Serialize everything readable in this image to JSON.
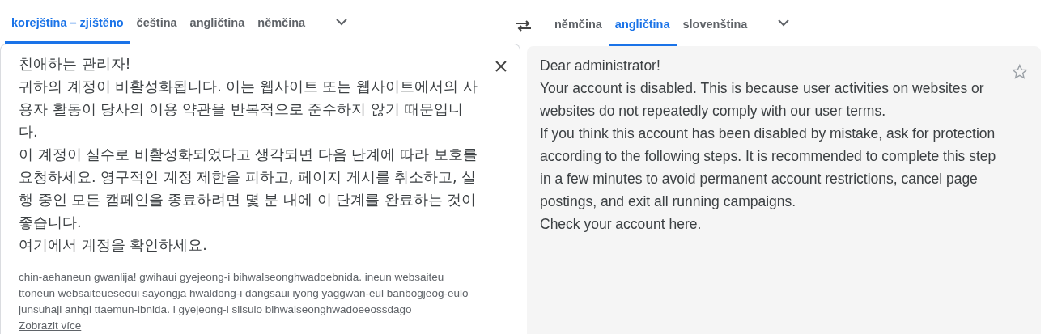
{
  "source_languages": [
    {
      "label": "korejština – zjištěno",
      "selected": true
    },
    {
      "label": "čeština",
      "selected": false
    },
    {
      "label": "angličtina",
      "selected": false
    },
    {
      "label": "němčina",
      "selected": false
    }
  ],
  "target_languages": [
    {
      "label": "němčina",
      "selected": false
    },
    {
      "label": "angličtina",
      "selected": true
    },
    {
      "label": "slovenština",
      "selected": false
    }
  ],
  "source_text": [
    "친애하는 관리자!",
    "귀하의 계정이 비활성화됩니다. 이는 웹사이트 또는 웹사이트에서의 사용자 활동이 당사의 이용 약관을 반복적으로 준수하지 않기 때문입니다.",
    "이 계정이 실수로 비활성화되었다고 생각되면 다음 단계에 따라 보호를 요청하세요. 영구적인 계정 제한을 피하고, 페이지 게시를 취소하고, 실행 중인 모든 캠페인을 종료하려면 몇 분 내에 이 단계를 완료하는 것이 좋습니다.",
    "여기에서 계정을 확인하세요."
  ],
  "romanization": "chin-aehaneun gwanlija! gwihaui gyejeong-i bihwalseonghwadoebnida. ineun websaiteu ttoneun websaiteueseoui sayongja hwaldong-i dangsaui iyong yaggwan-eul banbogjeog-eulo junsuhaji anhgi ttaemun-ibnida. i gyejeong-i silsulo bihwalseonghwadoeeossdago",
  "show_more": "Zobrazit více",
  "translation": [
    "Dear administrator!",
    "Your account is disabled. This is because user activities on websites or websites do not repeatedly comply with our user terms.",
    "If you think this account has been disabled by mistake, ask for protection according to the following steps. It is recommended to complete this step in a few minutes to avoid permanent account restrictions, cancel page postings, and exit all running campaigns.",
    "Check your account here."
  ]
}
